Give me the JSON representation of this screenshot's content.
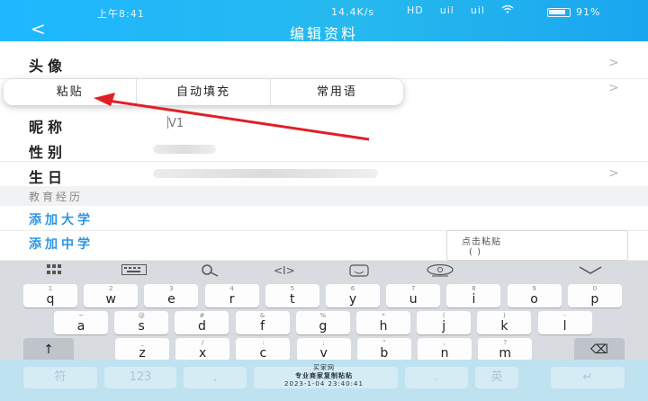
{
  "status_bar": {
    "time": "上午8:41",
    "speed": "14.4K/s",
    "signal1": "HD",
    "signal2": "uil",
    "signal3": "uil",
    "wifi_icon": "wifi-icon",
    "battery": "91%"
  },
  "nav": {
    "back": "<",
    "title": "编辑资料"
  },
  "rows": {
    "avatar": "头像",
    "nickname": "昵称",
    "nickname_value": "V1",
    "gender": "性别",
    "birthday": "生日"
  },
  "popup": {
    "paste": "粘贴",
    "autofill": "自动填充",
    "common_phrases": "常用语"
  },
  "education": {
    "section_title": "教育经历",
    "add_university": "添加大学",
    "add_middle_school": "添加中学"
  },
  "clipboard_tip": {
    "line1": "点击粘贴",
    "line2": "( )"
  },
  "keyboard": {
    "toolbar_icons": [
      "grid-icon",
      "keyboard-icon",
      "search-icon",
      "cursor-icon",
      "emoji-icon",
      "voice-icon",
      "collapse-icon"
    ],
    "row1": [
      {
        "ch": "q",
        "hint": "1"
      },
      {
        "ch": "w",
        "hint": "2"
      },
      {
        "ch": "e",
        "hint": "3"
      },
      {
        "ch": "r",
        "hint": "4"
      },
      {
        "ch": "t",
        "hint": "5"
      },
      {
        "ch": "y",
        "hint": "6"
      },
      {
        "ch": "u",
        "hint": "7"
      },
      {
        "ch": "i",
        "hint": "8"
      },
      {
        "ch": "o",
        "hint": "9"
      },
      {
        "ch": "p",
        "hint": "0"
      }
    ],
    "row2": [
      {
        "ch": "a",
        "hint": "~"
      },
      {
        "ch": "s",
        "hint": "@"
      },
      {
        "ch": "d",
        "hint": "#"
      },
      {
        "ch": "f",
        "hint": "&"
      },
      {
        "ch": "g",
        "hint": "%"
      },
      {
        "ch": "h",
        "hint": "*"
      },
      {
        "ch": "j",
        "hint": "("
      },
      {
        "ch": "k",
        "hint": ")"
      },
      {
        "ch": "l",
        "hint": "-"
      }
    ],
    "row3": [
      {
        "ch": "z",
        "hint": "_"
      },
      {
        "ch": "x",
        "hint": "/"
      },
      {
        "ch": "c",
        "hint": ":"
      },
      {
        "ch": "v",
        "hint": ";"
      },
      {
        "ch": "b",
        "hint": "\""
      },
      {
        "ch": "n",
        "hint": ","
      },
      {
        "ch": "m",
        "hint": "?"
      }
    ],
    "shift": "↑",
    "backspace": "⌫",
    "bottom": {
      "symbols": "符",
      "numbers": "123",
      "comma": ",",
      "space": "space",
      "period": ".",
      "lang": "英",
      "enter": "↵"
    },
    "watermark_line1": "买家网",
    "watermark_line2": "专业商家复制粘贴",
    "watermark_line3": "2023-1-04 23:40:41"
  },
  "colors": {
    "header": "#26b9ee",
    "link_blue": "#2f94e0",
    "annotation_red": "#e01f26"
  }
}
